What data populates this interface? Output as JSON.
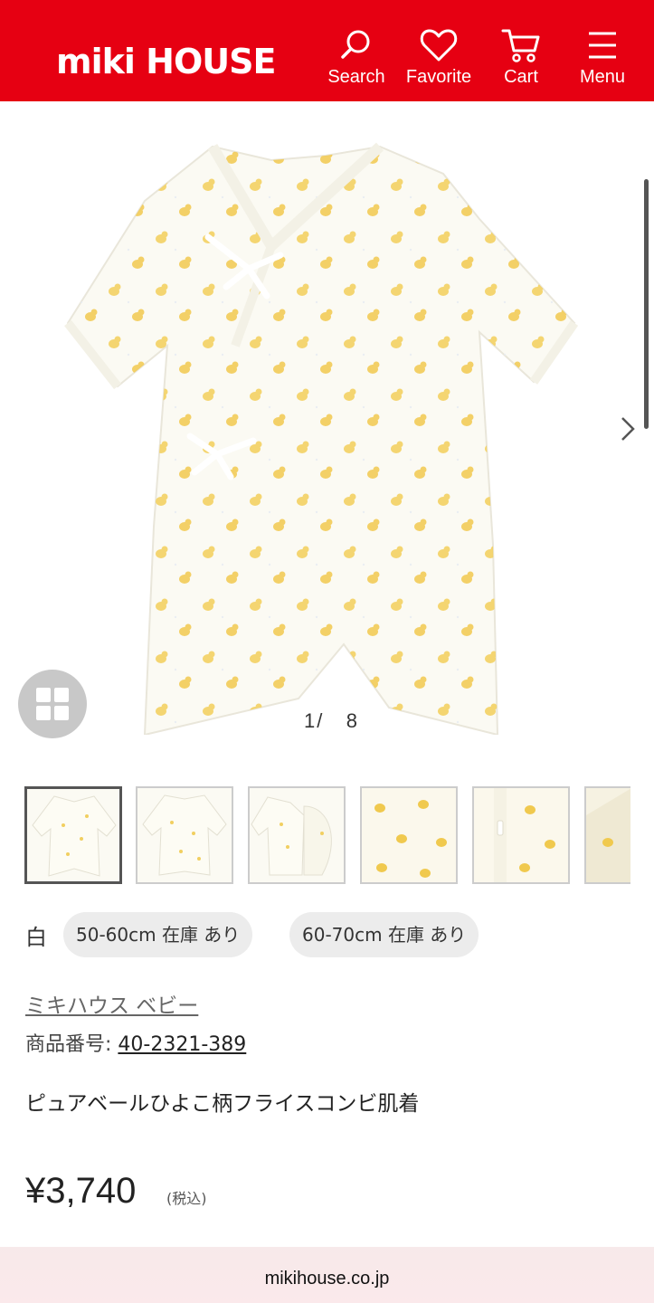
{
  "header": {
    "logo": "miki HOUSE",
    "search_label": "Search",
    "favorite_label": "Favorite",
    "cart_label": "Cart",
    "menu_label": "Menu",
    "brand_color": "#e60012"
  },
  "gallery": {
    "current_page": "1",
    "separator": "/",
    "total_pages": "8",
    "thumbnail_count": 6
  },
  "variants": {
    "color": "白",
    "sizes": [
      {
        "label": "50-60cm 在庫 あり"
      },
      {
        "label": "60-70cm 在庫 あり"
      }
    ]
  },
  "product": {
    "brand": "ミキハウス ベビー",
    "code_label": "商品番号:",
    "code": "40-2321-389",
    "name": "ピュアベールひよこ柄フライスコンビ肌着",
    "price": "¥3,740",
    "tax_note": "(税込)"
  },
  "footer": {
    "domain": "mikihouse.co.jp"
  }
}
